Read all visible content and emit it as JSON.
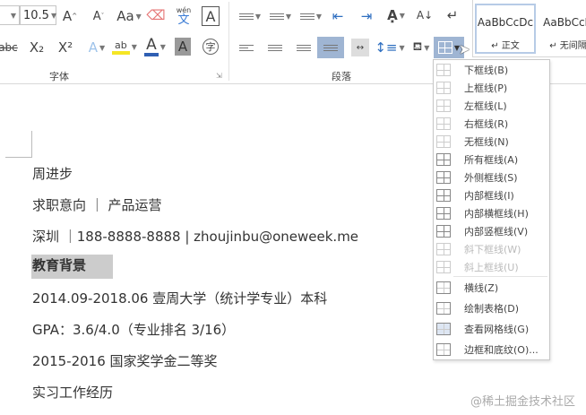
{
  "ribbon": {
    "font_size": "10.5",
    "font_group_label": "字体",
    "paragraph_group_label": "段落",
    "buttons_font": [
      "grow-font",
      "shrink-font",
      "change-case",
      "clear-formatting",
      "phonetic-guide",
      "character-border",
      "strikethrough",
      "subscript",
      "superscript",
      "text-effects",
      "highlight",
      "font-color",
      "character-shading",
      "enclose-characters"
    ],
    "labels": {
      "grow": "A",
      "shrink": "A",
      "case": "Aa",
      "phonetic_top": "wén",
      "phonetic_bottom": "文",
      "border_a": "A",
      "strike": "abc",
      "sub": "X₂",
      "sup": "X²",
      "effects": "A",
      "highlight": "ab",
      "color": "A",
      "shade": "A",
      "enclose": "字"
    },
    "colors": {
      "highlight": "#f5e625",
      "font_color": "#2f5fb3",
      "selected": "#9fb5d3"
    }
  },
  "styles": [
    {
      "preview": "AaBbCcDc",
      "name": "↵ 正文"
    },
    {
      "preview": "AaBbCcD",
      "name": "↵ 无间隔"
    }
  ],
  "document": {
    "lines": [
      "周进步",
      "求职意向 ｜ 产品运营",
      "深圳 ｜188-8888-8888 | zhoujinbu@oneweek.me",
      "教育背景",
      "2014.09-2018.06 壹周大学（统计学专业）本科",
      "GPA：3.6/4.0（专业排名 3/16）",
      "2015-2016 国家奖学金二等奖",
      "实习工作经历"
    ]
  },
  "border_menu": {
    "items": [
      {
        "label": "下框线(B)",
        "enabled": true
      },
      {
        "label": "上框线(P)",
        "enabled": true
      },
      {
        "label": "左框线(L)",
        "enabled": true
      },
      {
        "label": "右框线(R)",
        "enabled": true
      },
      {
        "label": "无框线(N)",
        "enabled": true
      },
      {
        "label": "所有框线(A)",
        "enabled": true
      },
      {
        "label": "外侧框线(S)",
        "enabled": true
      },
      {
        "label": "内部框线(I)",
        "enabled": true
      },
      {
        "label": "内部横框线(H)",
        "enabled": true
      },
      {
        "label": "内部竖框线(V)",
        "enabled": true
      },
      {
        "label": "斜下框线(W)",
        "enabled": false
      },
      {
        "label": "斜上框线(U)",
        "enabled": false
      },
      {
        "label": "横线(Z)",
        "enabled": true
      },
      {
        "label": "绘制表格(D)",
        "enabled": true
      },
      {
        "label": "查看网格线(G)",
        "enabled": true
      },
      {
        "label": "边框和底纹(O)...",
        "enabled": true
      }
    ]
  },
  "watermark": "@稀土掘金技术社区"
}
